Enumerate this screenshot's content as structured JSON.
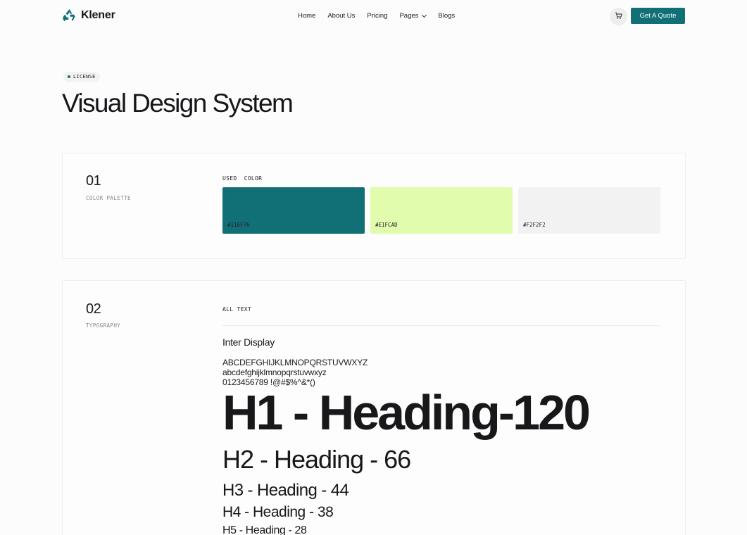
{
  "header": {
    "logo_text": "Klener",
    "logo_icon": "recycle-icon",
    "nav": [
      {
        "label": "Home"
      },
      {
        "label": "About Us"
      },
      {
        "label": "Pricing"
      },
      {
        "label": "Pages",
        "has_dropdown": true
      },
      {
        "label": "Blogs"
      }
    ],
    "cart_icon": "cart-icon",
    "cta_label": "Get A Quote"
  },
  "hero": {
    "badge": "LICENSE",
    "title": "Visual Design System"
  },
  "palette": {
    "number": "01",
    "label": "COLOR PALETTE",
    "heading": "USED  COLOR",
    "swatches": [
      {
        "code": "#116F76",
        "color": "#116f76"
      },
      {
        "code": "#E1FCAD",
        "color": "#e1fcad"
      },
      {
        "code": "#F2F2F2",
        "color": "#f2f2f2"
      }
    ]
  },
  "typography": {
    "number": "02",
    "label": "TYPOGRAPHY",
    "heading": "ALL TEXT",
    "font_name": "Inter Display",
    "uppercase": "ABCDEFGHIJKLMNOPQRSTUVWXYZ",
    "lowercase": "abcdefghijklmnopqrstuvwxyz",
    "symbols": "0123456789 !@#$%^&*()",
    "h1": "H1 - Heading-120",
    "h2": "H2 - Heading - 66",
    "h3": "H3 - Heading - 44",
    "h4": "H4 - Heading - 38",
    "h5": "H5 - Heading - 28"
  },
  "colors": {
    "brand": "#116f76",
    "accent": "#e1fcad"
  }
}
